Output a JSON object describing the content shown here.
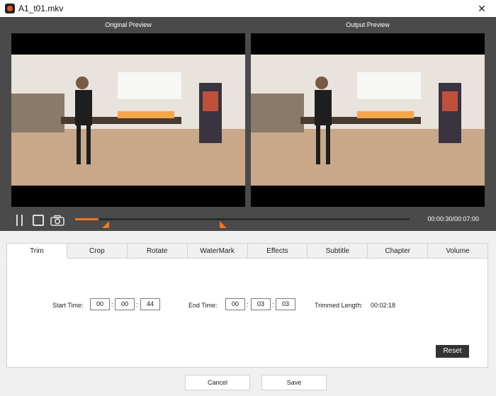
{
  "window": {
    "title": "A1_t01.mkv",
    "close_label": "✕"
  },
  "preview": {
    "original_label": "Original Preview",
    "output_label": "Output Preview"
  },
  "playback": {
    "time_display": "00:00:30/00:07:00",
    "progress_fraction": 0.07
  },
  "tabs": [
    "Trim",
    "Crop",
    "Rotate",
    "WaterMark",
    "Effects",
    "Subtitle",
    "Chapter",
    "Volume"
  ],
  "active_tab": "Trim",
  "trim": {
    "start_label": "Start Time:",
    "start": [
      "00",
      "00",
      "44"
    ],
    "end_label": "End Time:",
    "end": [
      "00",
      "03",
      "03"
    ],
    "trimmed_label": "Trimmed Length:",
    "trimmed_value": "00:02:18",
    "separator": ":"
  },
  "buttons": {
    "reset": "Reset",
    "cancel": "Cancel",
    "save": "Save"
  },
  "colors": {
    "accent": "#f07623",
    "preview_bg": "#4a4a4a",
    "reset_bg": "#333333"
  }
}
